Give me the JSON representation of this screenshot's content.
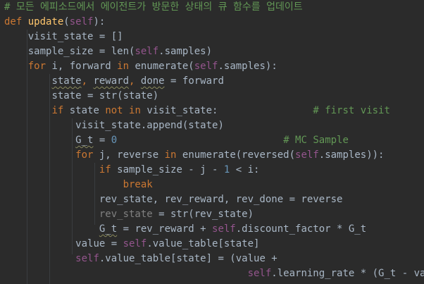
{
  "editor": {
    "colors": {
      "background": "#2B2B2B",
      "keyword": "#CC7832",
      "function": "#FFC66D",
      "self": "#94558D",
      "number": "#6897BB",
      "comment": "#629755",
      "identifier": "#A9B7C6",
      "unused": "#808080"
    },
    "lines": [
      {
        "indent": "",
        "tokens": [
          {
            "text": "# 모든 에피소드에서 에이전트가 방문한 상태의 큐 함수를 업데이트",
            "kind": "com"
          }
        ]
      },
      {
        "indent": "",
        "tokens": [
          {
            "text": "def ",
            "kind": "kw"
          },
          {
            "text": "update",
            "kind": "fn"
          },
          {
            "text": "(",
            "kind": "id"
          },
          {
            "text": "self",
            "kind": "self"
          },
          {
            "text": "):",
            "kind": "id"
          }
        ]
      },
      {
        "indent": "    ",
        "tokens": [
          {
            "text": "visit_state = []",
            "kind": "id"
          }
        ]
      },
      {
        "indent": "    ",
        "tokens": [
          {
            "text": "sample_size = len(",
            "kind": "id"
          },
          {
            "text": "self",
            "kind": "self"
          },
          {
            "text": ".samples)",
            "kind": "id"
          }
        ]
      },
      {
        "indent": "    ",
        "tokens": [
          {
            "text": "for ",
            "kind": "kw"
          },
          {
            "text": "i, forward ",
            "kind": "id"
          },
          {
            "text": "in ",
            "kind": "kw"
          },
          {
            "text": "enumerate(",
            "kind": "id"
          },
          {
            "text": "self",
            "kind": "self"
          },
          {
            "text": ".samples):",
            "kind": "id"
          }
        ]
      },
      {
        "indent": "        ",
        "tokens": [
          {
            "text": "state",
            "kind": "id",
            "wavy": true
          },
          {
            "text": ", ",
            "kind": "kw"
          },
          {
            "text": "reward",
            "kind": "id",
            "wavy": true
          },
          {
            "text": ", ",
            "kind": "kw"
          },
          {
            "text": "done",
            "kind": "id",
            "wavy": true
          },
          {
            "text": " = forward",
            "kind": "id"
          }
        ]
      },
      {
        "indent": "        ",
        "tokens": [
          {
            "text": "state = str(state)",
            "kind": "id"
          }
        ]
      },
      {
        "indent": "        ",
        "tokens": [
          {
            "text": "if ",
            "kind": "kw"
          },
          {
            "text": "state ",
            "kind": "id"
          },
          {
            "text": "not in ",
            "kind": "kw"
          },
          {
            "text": "visit_state:                ",
            "kind": "id"
          },
          {
            "text": "# first visit",
            "kind": "com"
          }
        ]
      },
      {
        "indent": "            ",
        "tokens": [
          {
            "text": "visit_state.append(state)",
            "kind": "id"
          }
        ]
      },
      {
        "indent": "            ",
        "tokens": [
          {
            "text": "G_t",
            "kind": "id",
            "wavy": true
          },
          {
            "text": " = ",
            "kind": "id"
          },
          {
            "text": "0",
            "kind": "num"
          },
          {
            "text": "                            ",
            "kind": "id"
          },
          {
            "text": "# MC Sample",
            "kind": "com"
          }
        ]
      },
      {
        "indent": "            ",
        "tokens": [
          {
            "text": "for ",
            "kind": "kw"
          },
          {
            "text": "j, reverse ",
            "kind": "id"
          },
          {
            "text": "in ",
            "kind": "kw"
          },
          {
            "text": "enumerate(reversed(",
            "kind": "id"
          },
          {
            "text": "self",
            "kind": "self"
          },
          {
            "text": ".samples)):",
            "kind": "id"
          }
        ]
      },
      {
        "indent": "                ",
        "tokens": [
          {
            "text": "if ",
            "kind": "kw"
          },
          {
            "text": "sample_size - j - ",
            "kind": "id"
          },
          {
            "text": "1",
            "kind": "num"
          },
          {
            "text": " < i:",
            "kind": "id"
          }
        ]
      },
      {
        "indent": "                    ",
        "tokens": [
          {
            "text": "break",
            "kind": "kw"
          }
        ]
      },
      {
        "indent": "                ",
        "tokens": [
          {
            "text": "rev_state, rev_reward, rev_done = reverse",
            "kind": "id"
          }
        ]
      },
      {
        "indent": "                ",
        "tokens": [
          {
            "text": "rev_state",
            "kind": "dim"
          },
          {
            "text": " = str(rev_state)",
            "kind": "id"
          }
        ]
      },
      {
        "indent": "                ",
        "tokens": [
          {
            "text": "G_t",
            "kind": "id",
            "wavy": true
          },
          {
            "text": " = rev_reward + ",
            "kind": "id"
          },
          {
            "text": "self",
            "kind": "self"
          },
          {
            "text": ".discount_factor * G_t",
            "kind": "id"
          }
        ]
      },
      {
        "indent": "            ",
        "tokens": [
          {
            "text": "value = ",
            "kind": "id"
          },
          {
            "text": "self",
            "kind": "self"
          },
          {
            "text": ".value_table[state]",
            "kind": "id"
          }
        ]
      },
      {
        "indent": "            ",
        "tokens": [
          {
            "text": "self",
            "kind": "self"
          },
          {
            "text": ".value_table[state] = (value +",
            "kind": "id"
          }
        ]
      },
      {
        "indent": "                                         ",
        "tokens": [
          {
            "text": "self",
            "kind": "self"
          },
          {
            "text": ".learning_rate * (G_t - value))",
            "kind": "id"
          }
        ]
      }
    ]
  }
}
